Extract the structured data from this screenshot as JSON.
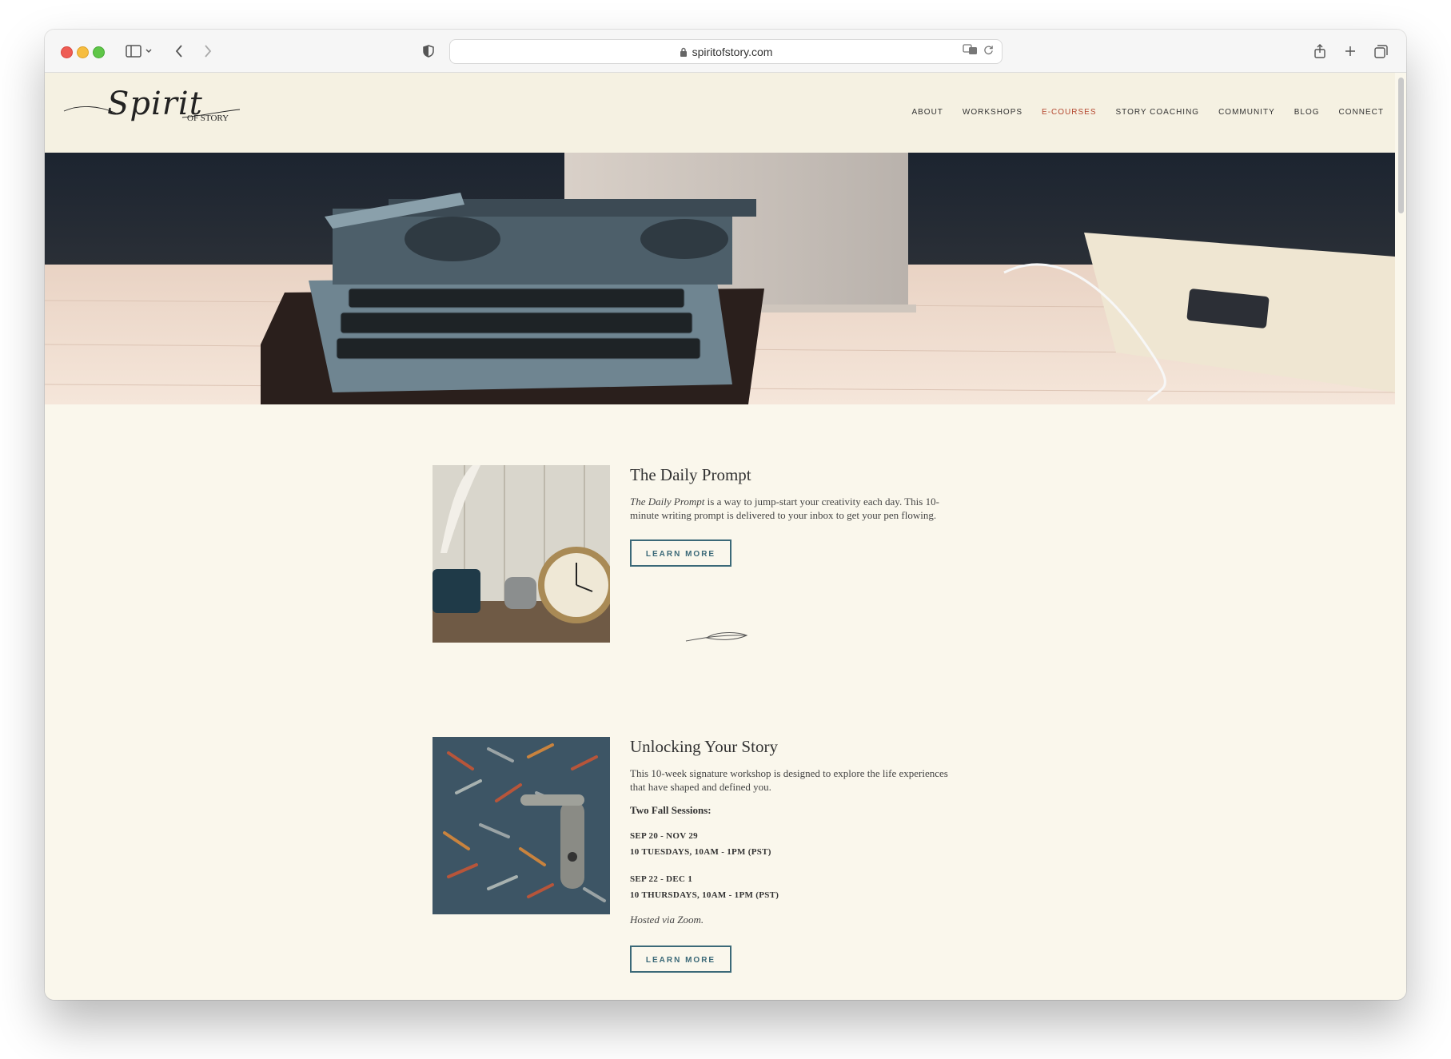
{
  "browser": {
    "url": "spiritofstory.com"
  },
  "site": {
    "logo": {
      "script": "Spirit",
      "subtitle": "OF STORY"
    },
    "nav": [
      {
        "label": "ABOUT",
        "active": false
      },
      {
        "label": "WORKSHOPS",
        "active": false
      },
      {
        "label": "E-COURSES",
        "active": true
      },
      {
        "label": "STORY COACHING",
        "active": false
      },
      {
        "label": "COMMUNITY",
        "active": false
      },
      {
        "label": "BLOG",
        "active": false
      },
      {
        "label": "CONNECT",
        "active": false
      }
    ],
    "colors": {
      "accent": "#b4472f",
      "button": "#3b6978",
      "background": "#faf7ec"
    }
  },
  "courses": [
    {
      "title": "The Daily Prompt",
      "desc_italic": "The Daily Prompt",
      "desc_rest": " is a way to jump-start your creativity each day. This 10-minute writing prompt is delivered to your inbox to get your pen flowing.",
      "button": "LEARN MORE"
    },
    {
      "title": "Unlocking Your Story",
      "desc": "This 10-week signature workshop is designed to explore the life experiences that have shaped and defined you.",
      "sessions_label": "Two Fall Sessions:",
      "sessions": [
        {
          "dates": "SEP 20 - NOV 29",
          "schedule": "10 TUESDAYS, 10AM - 1PM (PST)"
        },
        {
          "dates": "SEP 22 - DEC 1",
          "schedule": "10 THURSDAYS, 10AM - 1PM (PST)"
        }
      ],
      "hosted": "Hosted via Zoom.",
      "button": "LEARN MORE"
    }
  ]
}
